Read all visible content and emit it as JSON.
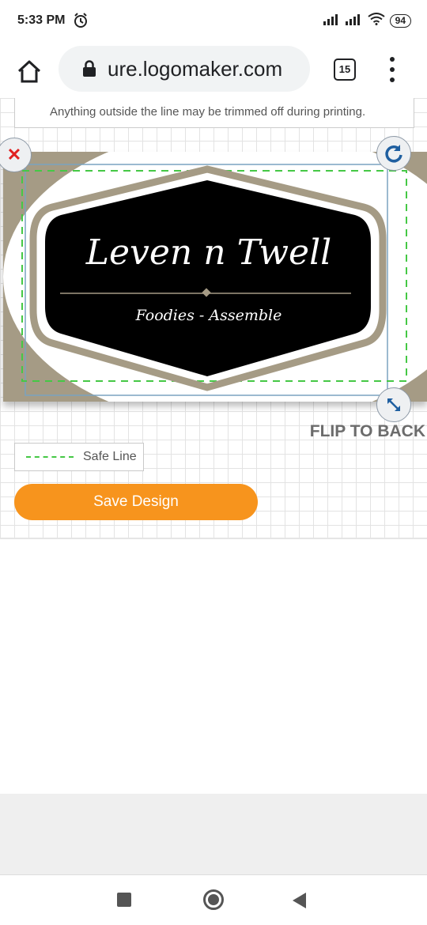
{
  "status_bar": {
    "time": "5:33 PM",
    "battery": "94",
    "icons": [
      "alarm-icon",
      "signal-icon",
      "signal-icon",
      "wifi-icon",
      "battery-icon"
    ]
  },
  "browser": {
    "url": "ure.logomaker.com",
    "tab_count": "15",
    "icons": [
      "home-icon",
      "lock-icon",
      "tabs-icon",
      "more-vert-icon"
    ]
  },
  "editor": {
    "notice": "Anything outside the line may be trimmed off during printing.",
    "logo": {
      "title": "Leven n Twell",
      "tagline": "Foodies - Assemble",
      "colors": {
        "background": "#a59b85",
        "badge": "#000000",
        "badge_ring": "#a59b85",
        "text": "#ffffff"
      }
    },
    "handles": {
      "delete_icon": "close-icon",
      "rotate_icon": "rotate-icon",
      "resize_icon": "resize-icon"
    },
    "flip_label": "FLIP TO BACK",
    "safe_line_label": "Safe Line",
    "save_label": "Save Design",
    "colors": {
      "accent": "#f7941d",
      "safe_line": "#45c845"
    }
  },
  "nav_bar": {
    "icons": [
      "recents-icon",
      "home-circle-icon",
      "back-icon"
    ]
  }
}
